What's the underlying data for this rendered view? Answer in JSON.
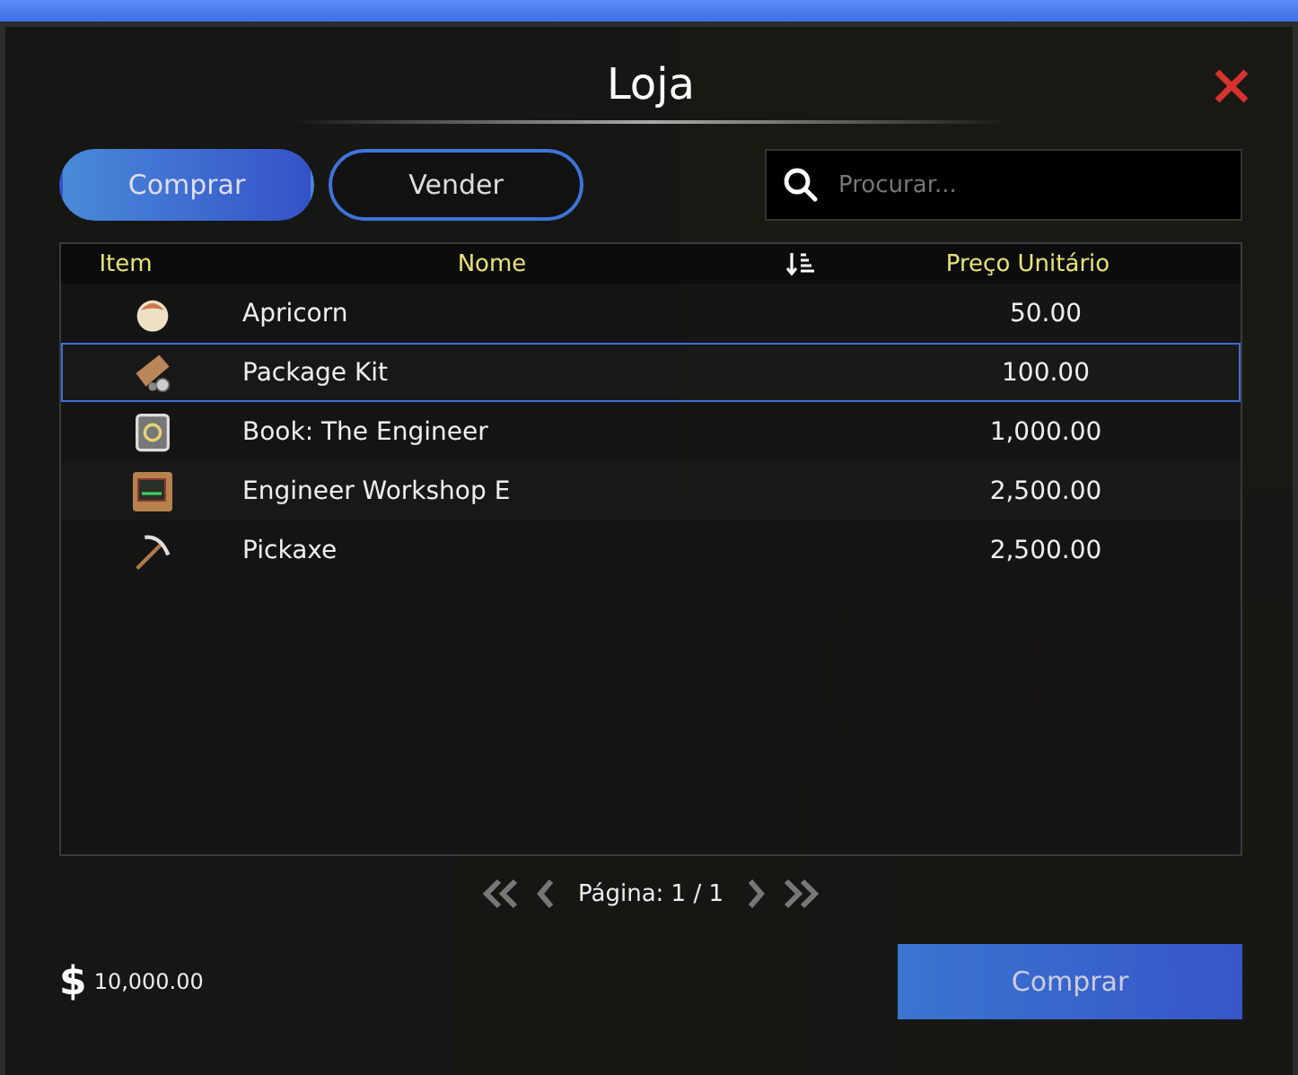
{
  "window": {
    "title": "Loja"
  },
  "tabs": [
    {
      "label": "Comprar",
      "selected": true
    },
    {
      "label": "Vender",
      "selected": false
    }
  ],
  "search": {
    "placeholder": "Procurar..."
  },
  "table": {
    "columns": [
      "Item",
      "Nome",
      "Preço Unitário"
    ],
    "rows": [
      {
        "name": "Apricorn",
        "price": "50.00",
        "selected": false
      },
      {
        "name": "Package Kit",
        "price": "100.00",
        "selected": true
      },
      {
        "name": "Book: The Engineer",
        "price": "1,000.00",
        "selected": false
      },
      {
        "name": "Engineer Workshop E",
        "price": "2,500.00",
        "selected": false
      },
      {
        "name": "Pickaxe",
        "price": "2,500.00",
        "selected": false
      }
    ]
  },
  "pagination": {
    "label": "Página: 1 / 1"
  },
  "balance": {
    "symbol": "$",
    "amount": "10,000.00"
  },
  "buy_button": {
    "label": "Comprar"
  }
}
